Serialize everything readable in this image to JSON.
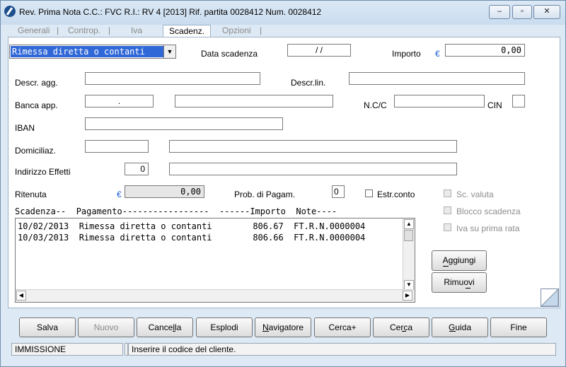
{
  "window": {
    "title": "Rev. Prima Nota C.C.: FVC  R.I.: RV      4 [2013]   Rif. partita 0028412 Num. 0028412",
    "minimize_glyph": "–",
    "maximize_glyph": "▫",
    "close_glyph": "✕"
  },
  "tabs": [
    {
      "label": "Generali"
    },
    {
      "label": "Controp."
    },
    {
      "label": "Iva"
    },
    {
      "label": "Scadenz."
    },
    {
      "label": "Opzioni"
    }
  ],
  "tab_separator": "|",
  "active_tab": "Scadenz.",
  "form": {
    "payment_type": "Rimessa diretta o contanti",
    "data_scadenza_label": "Data scadenza",
    "data_scadenza_value": "/   /",
    "importo_label": "Importo",
    "currency_symbol": "€",
    "importo_value": "0,00",
    "descr_agg_label": "Descr. agg.",
    "descr_agg_value": "",
    "descr_lin_label": "Descr.lin.",
    "descr_lin_value": "",
    "banca_app_label": "Banca app.",
    "banca_app_code": ".",
    "banca_app_name": "",
    "ncc_label": "N.C/C",
    "ncc_value": "",
    "cin_label": "CIN",
    "cin_value": "",
    "iban_label": "IBAN",
    "iban_value": "",
    "domiciliaz_label": "Domiciliaz.",
    "domiciliaz_code": "",
    "domiciliaz_name": "",
    "indirizzo_label": "Indirizzo Effetti",
    "indirizzo_code": "0",
    "indirizzo_desc": "",
    "ritenuta_label": "Ritenuta",
    "ritenuta_value": "0,00",
    "prob_label": "Prob. di Pagam.",
    "prob_value": "0",
    "estr_conto_label": "Estr.conto",
    "sc_valuta_label": "Sc. valuta",
    "blocco_label": "Blocco scadenza",
    "iva_label": "Iva su prima rata"
  },
  "list": {
    "header": "Scadenza--  Pagamento-----------------  ------Importo  Note----",
    "rows": [
      "10/02/2013  Rimessa diretta o contanti        806.67  FT.R.N.0000004",
      "10/03/2013  Rimessa diretta o contanti        806.66  FT.R.N.0000004"
    ],
    "scroll_up": "▲",
    "scroll_down": "▼",
    "scroll_left": "◀",
    "scroll_right": "▶"
  },
  "side_buttons": {
    "aggiungi": "Aggiungi",
    "rimuovi": "Rimuovi"
  },
  "toolbar": {
    "salva": "Salva",
    "nuovo": "Nuovo",
    "cancella": "Cancella",
    "esplodi": "Esplodi",
    "navigatore": "Navigatore",
    "cerca_plus": "Cerca+",
    "cerca": "Cerca",
    "guida": "Guida",
    "fine": "Fine"
  },
  "status": {
    "mode": "IMMISSIONE",
    "empty": "",
    "message": "Inserire il codice del cliente."
  },
  "colors": {
    "accent": "#3168d8",
    "euro": "#1a5fd1",
    "window_bg": "#dde9f4"
  }
}
